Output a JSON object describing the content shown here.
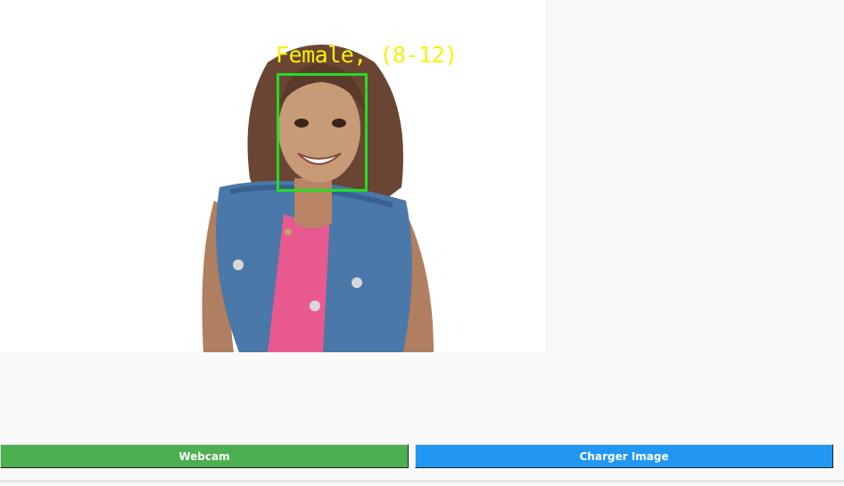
{
  "detection": {
    "label": "Female, (8-12)",
    "label_color": "#f7f200",
    "box_color": "#22dd22"
  },
  "buttons": {
    "webcam_label": "Webcam",
    "webcam_color": "#4caf50",
    "charger_label": "Charger Image",
    "charger_color": "#2196f3"
  }
}
